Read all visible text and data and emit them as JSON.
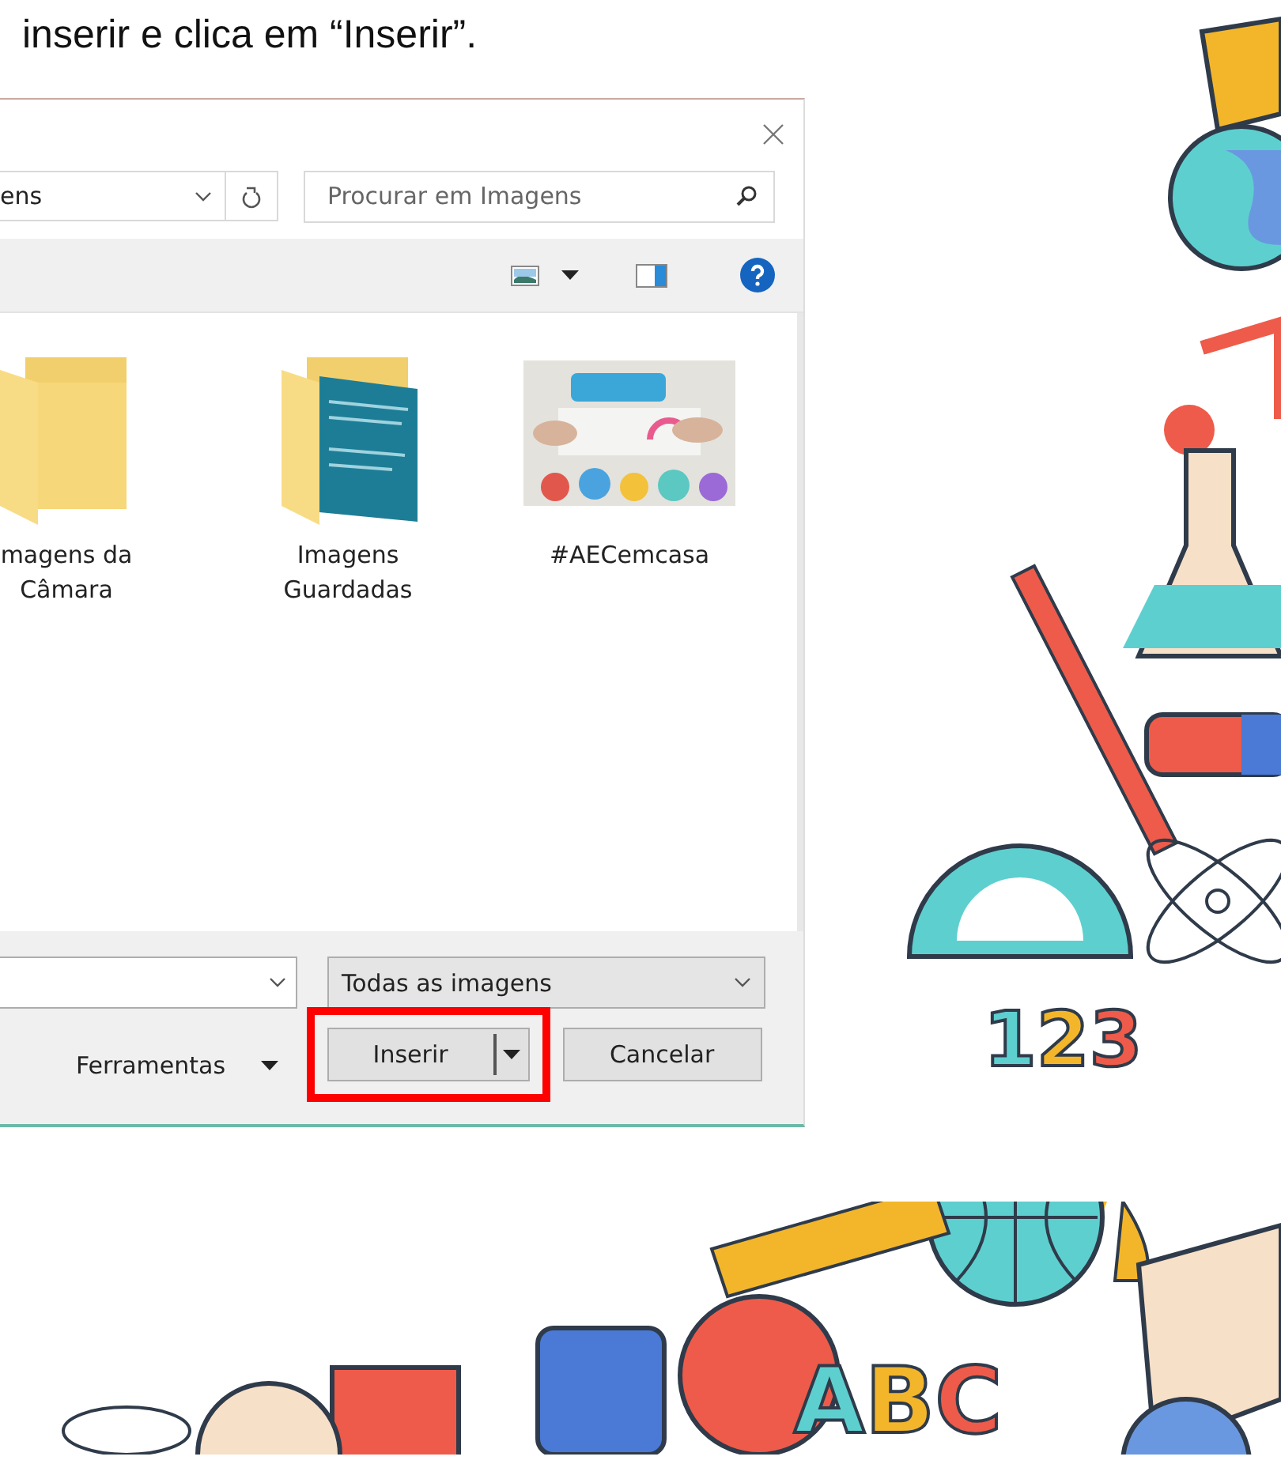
{
  "caption": "inserir e clica em “Inserir”.",
  "dialog": {
    "address": "ens",
    "search": {
      "placeholder": "Procurar em Imagens"
    },
    "items": [
      {
        "label": "magens da\nCâmara",
        "kind": "folder"
      },
      {
        "label": "Imagens\nGuardadas",
        "kind": "folder-preview"
      },
      {
        "label": "#AECemcasa"
      }
    ],
    "file_type": "Todas as imagens",
    "tools": "Ferramentas",
    "insert": "Inserir",
    "cancel": "Cancelar",
    "insert_highlighted": true
  },
  "stickers": [
    "123",
    "ABC"
  ]
}
